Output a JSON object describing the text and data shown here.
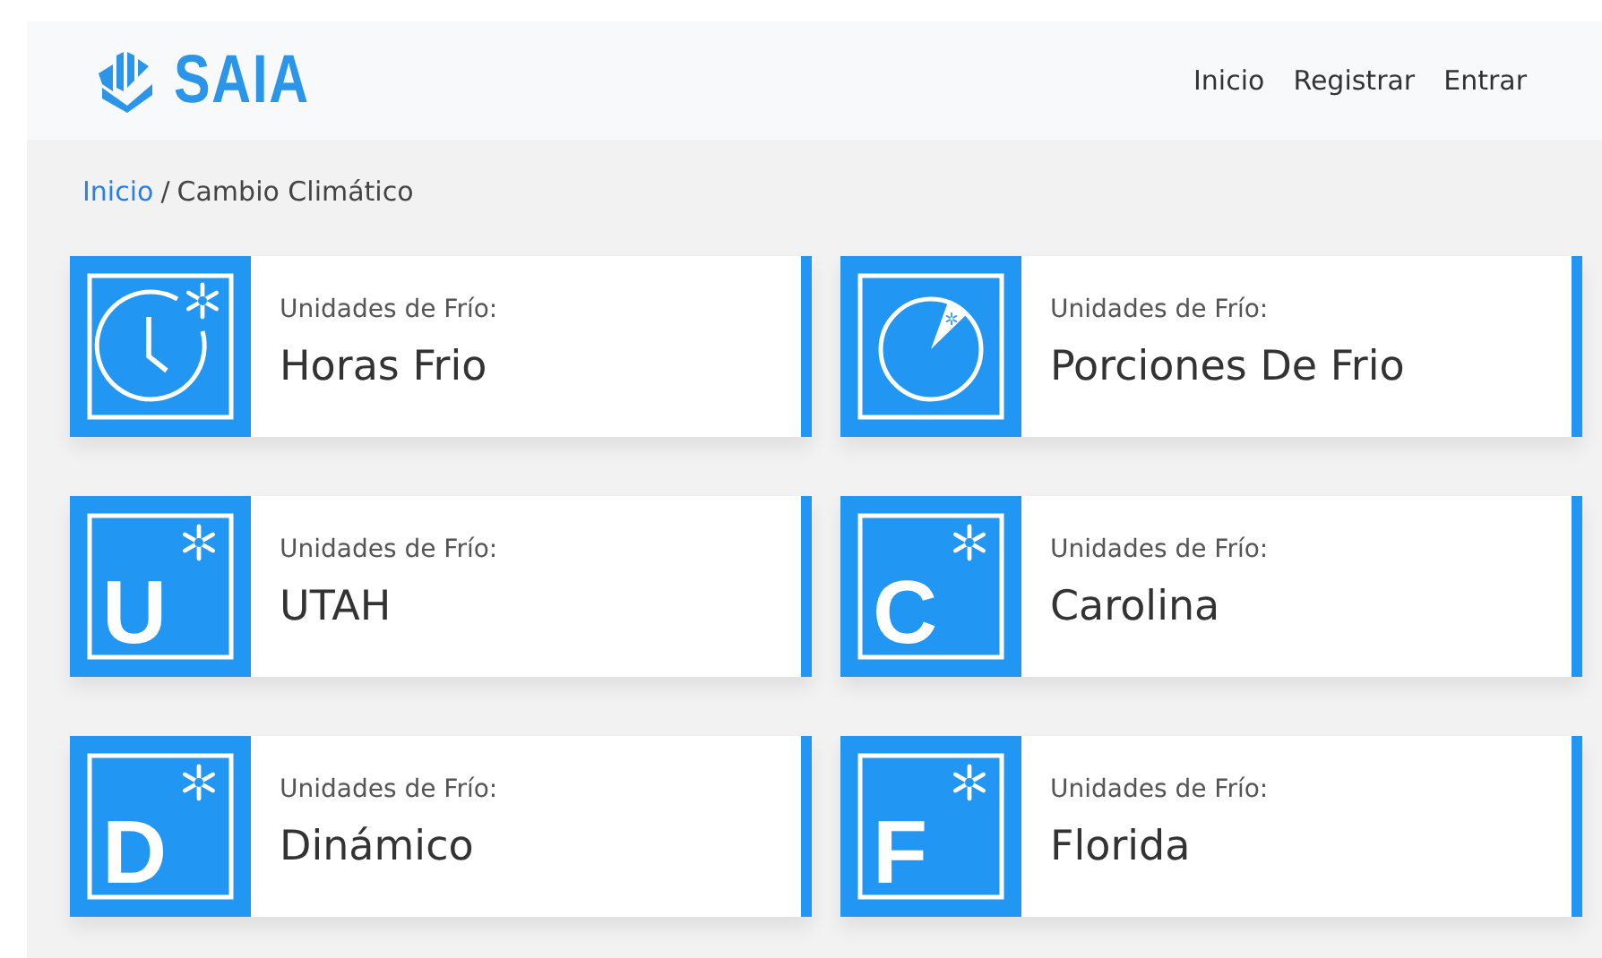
{
  "navbar": {
    "brand": "SAIA",
    "links": [
      {
        "label": "Inicio"
      },
      {
        "label": "Registrar"
      },
      {
        "label": "Entrar"
      }
    ]
  },
  "breadcrumb": {
    "separator": "/",
    "items": [
      {
        "label": "Inicio",
        "link": true
      },
      {
        "label": "Cambio Climático",
        "link": false
      }
    ]
  },
  "cards": [
    {
      "kind": "clock",
      "subtitle": "Unidades de Frío:",
      "title": "Horas Frio"
    },
    {
      "kind": "pie",
      "subtitle": "Unidades de Frío:",
      "title": "Porciones De Frio"
    },
    {
      "kind": "letter",
      "letter": "U",
      "subtitle": "Unidades de Frío:",
      "title": "UTAH"
    },
    {
      "kind": "letter",
      "letter": "C",
      "subtitle": "Unidades de Frío:",
      "title": "Carolina"
    },
    {
      "kind": "letter",
      "letter": "D",
      "subtitle": "Unidades de Frío:",
      "title": "Dinámico"
    },
    {
      "kind": "letter",
      "letter": "F",
      "subtitle": "Unidades de Frío:",
      "title": "Florida"
    }
  ]
}
